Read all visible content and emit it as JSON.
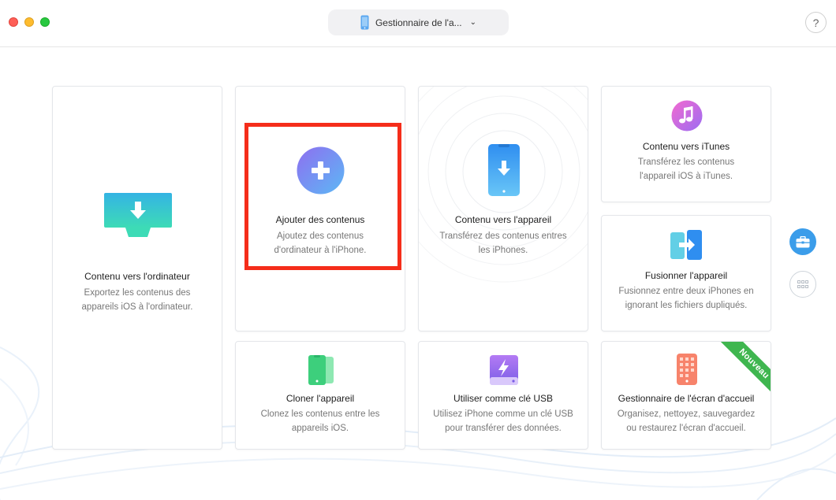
{
  "window": {
    "device_selector_label": "Gestionnaire de l'a...",
    "device_selector_icon": "iphone-icon",
    "help_label": "?"
  },
  "cards": {
    "to_computer": {
      "title": "Contenu vers l'ordinateur",
      "desc1": "Exportez les contenus des",
      "desc2": "appareils iOS à l'ordinateur.",
      "icon": "monitor-download-icon"
    },
    "add_content": {
      "title": "Ajouter des contenus",
      "desc1": "Ajoutez des contenus",
      "desc2": "d'ordinateur à l'iPhone.",
      "icon": "plus-circle-icon"
    },
    "to_device": {
      "title": "Contenu vers l'appareil",
      "desc1": "Transférez des contenus entres",
      "desc2": "les iPhones.",
      "icon": "phone-download-icon"
    },
    "to_itunes": {
      "title": "Contenu vers iTunes",
      "desc1": "Transférez les contenus",
      "desc2": "l'appareil iOS à iTunes.",
      "icon": "music-note-icon"
    },
    "merge": {
      "title": "Fusionner l'appareil",
      "desc1": "Fusionnez entre deux iPhones en",
      "desc2": "ignorant les fichiers dupliqués.",
      "icon": "merge-phones-icon"
    },
    "clone": {
      "title": "Cloner l'appareil",
      "desc1": "Clonez les contenus entre les",
      "desc2": "appareils iOS.",
      "icon": "clone-phones-icon"
    },
    "usb": {
      "title": "Utiliser comme clé USB",
      "desc1": "Utilisez iPhone comme un clé USB",
      "desc2": "pour transférer des données.",
      "icon": "usb-drive-icon"
    },
    "homescreen": {
      "title": "Gestionnaire de l'écran d'accueil",
      "desc1": "Organisez, nettoyez, sauvegardez",
      "desc2": "ou restaurez l'écran d'accueil.",
      "icon": "home-screen-icon",
      "badge": "Nouveau"
    }
  },
  "colors": {
    "accent_blue": "#3b9dea",
    "highlight_red": "#f52d1a",
    "badge_green": "#3fb64f"
  }
}
